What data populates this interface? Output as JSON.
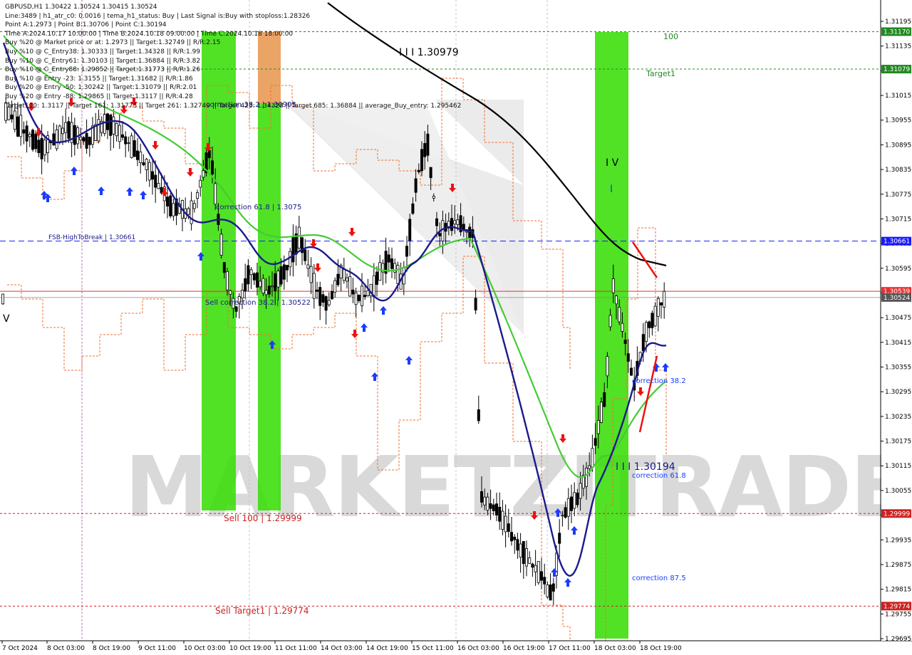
{
  "header": {
    "lines": [
      "GBPUSD,H1  1.30422 1.30524 1.30415 1.30524",
      "Line:3489 | h1_atr_c0: 0.0016 | tema_h1_status: Buy | Last Signal is:Buy with stoploss:1.28326",
      "Point A:1.2973 | Point B:1.30706 | Point C:1.30194",
      "Time A:2024.10.17 10:00:00 | Time B:2024.10.18 09:00:00 | Time C:2024.10.18 18:00:00",
      "Buy %20 @ Market price or at: 1.2973 || Target:1.32749 || R/R:2.15",
      "Buy %10 @ C_Entry38: 1.30333 || Target:1.34328 || R/R:1.99",
      "Buy %10 @ C_Entry61: 1.30103 || Target:1.36884 || R/R:3.82",
      "Buy %10 @ C_Entry88: 1.29852 || Target:1.31773 || R/R:1.26",
      "Buy %10 @ Entry -23: 1.3155 || Target:1.31682 || R/R:1.86",
      "Buy %20 @ Entry -50: 1.30242 || Target:1.31079 || R/R:2.01",
      "Buy %20 @ Entry -88: 1.29865 || Target:1.3117 || R/R:4.28",
      "Target100: 1.3117 || Target 161: 1.31773 || Target 261: 1.32749 || Target 423: 1.34328 || Target 685: 1.36884 || average_Buy_entry: 1.295462"
    ]
  },
  "watermark": "MARKETZITRADE",
  "annotations": {
    "wave_III": "I I I 1.30979",
    "wave_IV": "I V",
    "wave_I": "I",
    "wave_III_low": "I I I 1.30194",
    "wave_V": "V",
    "target_100": "100",
    "target1": "Target1",
    "fsb_high": "FSB-HighToBreak | 1.30661",
    "correction_618_top": "correction 61.8 | 1.3075",
    "correction_382_top": "correction 38.2 | 1.30905",
    "sell_correction": "Sell correction 38.2 | 1.30522",
    "sell_100": "Sell 100 | 1.29999",
    "sell_target1": "Sell Target1 | 1.29774",
    "correction_382": "correction 38.2",
    "correction_618": "correction 61.8",
    "correction_875": "correction 87.5"
  },
  "colors": {
    "background": "#ffffff",
    "up_candle": "#000000",
    "down_candle": "#000000",
    "green_zone": "#33dd00",
    "orange_zone": "#e89a55",
    "fsb_line": "#1a1aff",
    "red_level": "#e63232",
    "dark_red_level": "#cc2222",
    "green_level": "#228822",
    "tema_line": "#1a1a8c",
    "ma_green": "#44cc33",
    "ma_black": "#000000",
    "buy_arrow": "#1a3cff",
    "sell_arrow": "#ee1111",
    "orange_dashed": "#f07030"
  },
  "price_axis": {
    "ticks": [
      "1.31195",
      "1.31135",
      "1.31075",
      "1.31015",
      "1.30955",
      "1.30895",
      "1.30835",
      "1.30775",
      "1.30715",
      "1.30655",
      "1.30595",
      "1.30535",
      "1.30475",
      "1.30415",
      "1.30355",
      "1.30295",
      "1.30235",
      "1.30175",
      "1.30115",
      "1.30055",
      "1.29995",
      "1.29935",
      "1.29875",
      "1.29815",
      "1.29755",
      "1.29695"
    ],
    "badges": [
      {
        "label": "1.31170",
        "price": 1.3117,
        "color": "#228822"
      },
      {
        "label": "1.31079",
        "price": 1.31079,
        "color": "#228822"
      },
      {
        "label": "1.30661",
        "price": 1.30661,
        "color": "#1a1aff"
      },
      {
        "label": "1.30539",
        "price": 1.30539,
        "color": "#e63232"
      },
      {
        "label": "1.30524",
        "price": 1.30524,
        "color": "#555555"
      },
      {
        "label": "1.29999",
        "price": 1.29999,
        "color": "#cc2222"
      },
      {
        "label": "1.29774",
        "price": 1.29774,
        "color": "#cc2222"
      }
    ]
  },
  "time_axis": {
    "labels": [
      "7 Oct 2024",
      "8 Oct 03:00",
      "8 Oct 19:00",
      "9 Oct 11:00",
      "10 Oct 03:00",
      "10 Oct 19:00",
      "11 Oct 11:00",
      "14 Oct 03:00",
      "14 Oct 19:00",
      "15 Oct 11:00",
      "16 Oct 03:00",
      "16 Oct 19:00",
      "17 Oct 11:00",
      "18 Oct 03:00",
      "18 Oct 19:00"
    ]
  }
}
